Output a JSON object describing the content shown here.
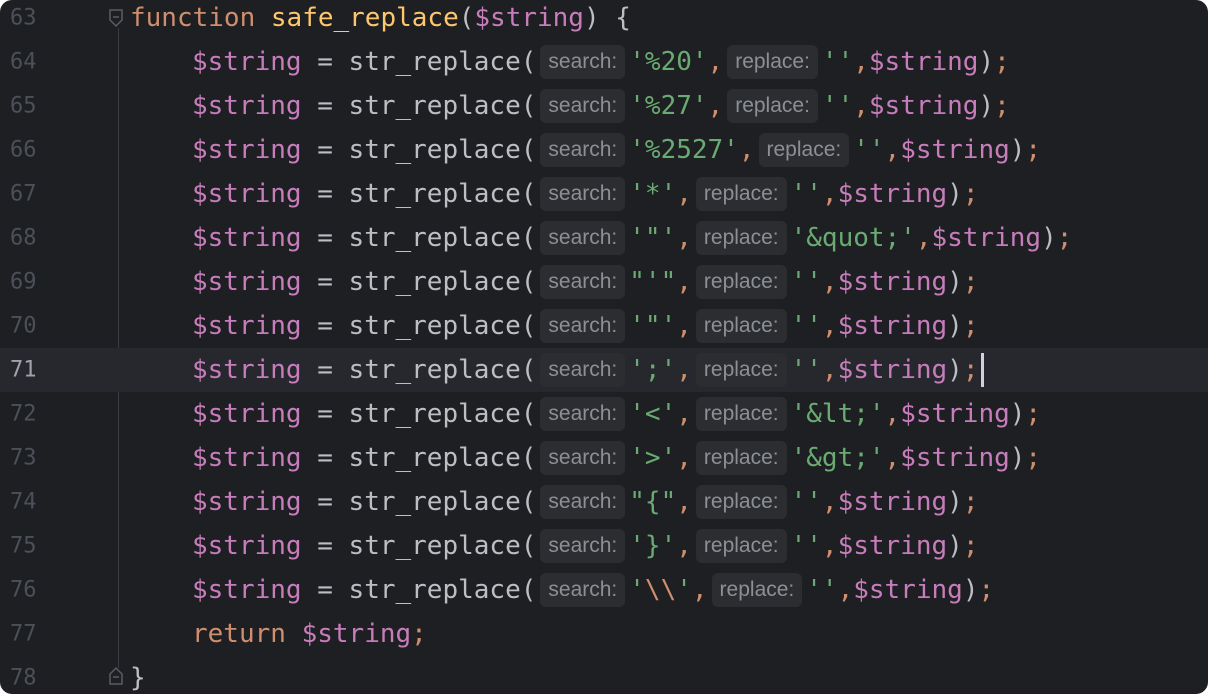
{
  "editor": {
    "language": "PHP",
    "current_line": "71",
    "header": {
      "line_number": "63",
      "keyword": "function",
      "function_name": "safe_replace",
      "open_paren": "(",
      "param": "$string",
      "close": ") {"
    },
    "hints": {
      "search": "search:",
      "replace": "replace:"
    },
    "calls": [
      {
        "line_number": "64",
        "var": "$string",
        "assign": " = str_replace(",
        "search_value": "'%20'",
        "replace_value": "''",
        "arg": "$string",
        "close": ")"
      },
      {
        "line_number": "65",
        "var": "$string",
        "assign": " = str_replace(",
        "search_value": "'%27'",
        "replace_value": "''",
        "arg": "$string",
        "close": ")"
      },
      {
        "line_number": "66",
        "var": "$string",
        "assign": " = str_replace(",
        "search_value": "'%2527'",
        "replace_value": "''",
        "arg": "$string",
        "close": ")"
      },
      {
        "line_number": "67",
        "var": "$string",
        "assign": " = str_replace(",
        "search_value": "'*'",
        "replace_value": "''",
        "arg": "$string",
        "close": ")"
      },
      {
        "line_number": "68",
        "var": "$string",
        "assign": " = str_replace(",
        "search_value": "'\"'",
        "replace_value": "'&quot;'",
        "arg": "$string",
        "close": ")"
      },
      {
        "line_number": "69",
        "var": "$string",
        "assign": " = str_replace(",
        "search_value": "\"'\"",
        "replace_value": "''",
        "arg": "$string",
        "close": ")"
      },
      {
        "line_number": "70",
        "var": "$string",
        "assign": " = str_replace(",
        "search_value": "'\"'",
        "replace_value": "''",
        "arg": "$string",
        "close": ")"
      },
      {
        "line_number": "71",
        "var": "$string",
        "assign": " = str_replace(",
        "search_value": "';'",
        "replace_value": "''",
        "arg": "$string",
        "close": ")"
      },
      {
        "line_number": "72",
        "var": "$string",
        "assign": " = str_replace(",
        "search_value": "'<'",
        "replace_value": "'&lt;'",
        "arg": "$string",
        "close": ")"
      },
      {
        "line_number": "73",
        "var": "$string",
        "assign": " = str_replace(",
        "search_value": "'>'",
        "replace_value": "'&gt;'",
        "arg": "$string",
        "close": ")"
      },
      {
        "line_number": "74",
        "var": "$string",
        "assign": " = str_replace(",
        "search_value": "\"{\"",
        "replace_value": "''",
        "arg": "$string",
        "close": ")"
      },
      {
        "line_number": "75",
        "var": "$string",
        "assign": " = str_replace(",
        "search_value": "'}'",
        "replace_value": "''",
        "arg": "$string",
        "close": ")"
      },
      {
        "line_number": "76",
        "var": "$string",
        "assign": " = str_replace(",
        "search_value": "'\\\\'",
        "replace_value": "''",
        "arg": "$string",
        "close": ")"
      }
    ],
    "return_line": {
      "line_number": "77",
      "keyword": "return",
      "value": "$string",
      "semicolon": ";"
    },
    "closing_line": {
      "line_number": "78",
      "brace": "}"
    },
    "punctuation": {
      "comma": ",",
      "semicolon": ";"
    },
    "colors": {
      "background": "#1e1f22",
      "keyword": "#cf8e6d",
      "function_name": "#ffc66d",
      "variable": "#c77dbb",
      "string": "#6aab73",
      "hint_bg": "#2b2d30"
    }
  }
}
